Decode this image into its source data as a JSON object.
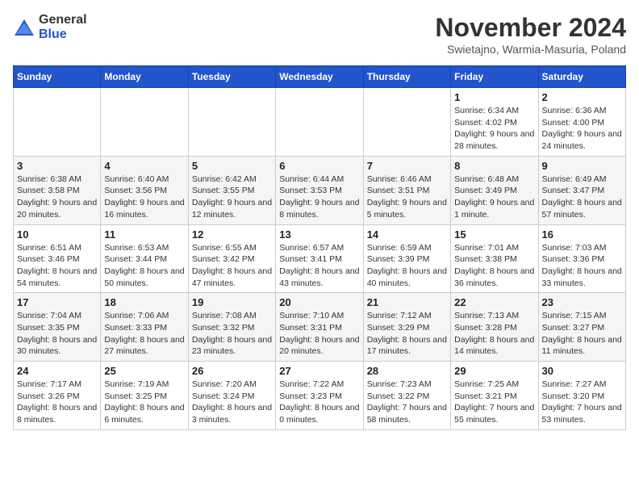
{
  "logo": {
    "general": "General",
    "blue": "Blue"
  },
  "header": {
    "month": "November 2024",
    "location": "Swietajno, Warmia-Masuria, Poland"
  },
  "weekdays": [
    "Sunday",
    "Monday",
    "Tuesday",
    "Wednesday",
    "Thursday",
    "Friday",
    "Saturday"
  ],
  "weeks": [
    [
      {
        "day": "",
        "info": ""
      },
      {
        "day": "",
        "info": ""
      },
      {
        "day": "",
        "info": ""
      },
      {
        "day": "",
        "info": ""
      },
      {
        "day": "",
        "info": ""
      },
      {
        "day": "1",
        "info": "Sunrise: 6:34 AM\nSunset: 4:02 PM\nDaylight: 9 hours and 28 minutes."
      },
      {
        "day": "2",
        "info": "Sunrise: 6:36 AM\nSunset: 4:00 PM\nDaylight: 9 hours and 24 minutes."
      }
    ],
    [
      {
        "day": "3",
        "info": "Sunrise: 6:38 AM\nSunset: 3:58 PM\nDaylight: 9 hours and 20 minutes."
      },
      {
        "day": "4",
        "info": "Sunrise: 6:40 AM\nSunset: 3:56 PM\nDaylight: 9 hours and 16 minutes."
      },
      {
        "day": "5",
        "info": "Sunrise: 6:42 AM\nSunset: 3:55 PM\nDaylight: 9 hours and 12 minutes."
      },
      {
        "day": "6",
        "info": "Sunrise: 6:44 AM\nSunset: 3:53 PM\nDaylight: 9 hours and 8 minutes."
      },
      {
        "day": "7",
        "info": "Sunrise: 6:46 AM\nSunset: 3:51 PM\nDaylight: 9 hours and 5 minutes."
      },
      {
        "day": "8",
        "info": "Sunrise: 6:48 AM\nSunset: 3:49 PM\nDaylight: 9 hours and 1 minute."
      },
      {
        "day": "9",
        "info": "Sunrise: 6:49 AM\nSunset: 3:47 PM\nDaylight: 8 hours and 57 minutes."
      }
    ],
    [
      {
        "day": "10",
        "info": "Sunrise: 6:51 AM\nSunset: 3:46 PM\nDaylight: 8 hours and 54 minutes."
      },
      {
        "day": "11",
        "info": "Sunrise: 6:53 AM\nSunset: 3:44 PM\nDaylight: 8 hours and 50 minutes."
      },
      {
        "day": "12",
        "info": "Sunrise: 6:55 AM\nSunset: 3:42 PM\nDaylight: 8 hours and 47 minutes."
      },
      {
        "day": "13",
        "info": "Sunrise: 6:57 AM\nSunset: 3:41 PM\nDaylight: 8 hours and 43 minutes."
      },
      {
        "day": "14",
        "info": "Sunrise: 6:59 AM\nSunset: 3:39 PM\nDaylight: 8 hours and 40 minutes."
      },
      {
        "day": "15",
        "info": "Sunrise: 7:01 AM\nSunset: 3:38 PM\nDaylight: 8 hours and 36 minutes."
      },
      {
        "day": "16",
        "info": "Sunrise: 7:03 AM\nSunset: 3:36 PM\nDaylight: 8 hours and 33 minutes."
      }
    ],
    [
      {
        "day": "17",
        "info": "Sunrise: 7:04 AM\nSunset: 3:35 PM\nDaylight: 8 hours and 30 minutes."
      },
      {
        "day": "18",
        "info": "Sunrise: 7:06 AM\nSunset: 3:33 PM\nDaylight: 8 hours and 27 minutes."
      },
      {
        "day": "19",
        "info": "Sunrise: 7:08 AM\nSunset: 3:32 PM\nDaylight: 8 hours and 23 minutes."
      },
      {
        "day": "20",
        "info": "Sunrise: 7:10 AM\nSunset: 3:31 PM\nDaylight: 8 hours and 20 minutes."
      },
      {
        "day": "21",
        "info": "Sunrise: 7:12 AM\nSunset: 3:29 PM\nDaylight: 8 hours and 17 minutes."
      },
      {
        "day": "22",
        "info": "Sunrise: 7:13 AM\nSunset: 3:28 PM\nDaylight: 8 hours and 14 minutes."
      },
      {
        "day": "23",
        "info": "Sunrise: 7:15 AM\nSunset: 3:27 PM\nDaylight: 8 hours and 11 minutes."
      }
    ],
    [
      {
        "day": "24",
        "info": "Sunrise: 7:17 AM\nSunset: 3:26 PM\nDaylight: 8 hours and 8 minutes."
      },
      {
        "day": "25",
        "info": "Sunrise: 7:19 AM\nSunset: 3:25 PM\nDaylight: 8 hours and 6 minutes."
      },
      {
        "day": "26",
        "info": "Sunrise: 7:20 AM\nSunset: 3:24 PM\nDaylight: 8 hours and 3 minutes."
      },
      {
        "day": "27",
        "info": "Sunrise: 7:22 AM\nSunset: 3:23 PM\nDaylight: 8 hours and 0 minutes."
      },
      {
        "day": "28",
        "info": "Sunrise: 7:23 AM\nSunset: 3:22 PM\nDaylight: 7 hours and 58 minutes."
      },
      {
        "day": "29",
        "info": "Sunrise: 7:25 AM\nSunset: 3:21 PM\nDaylight: 7 hours and 55 minutes."
      },
      {
        "day": "30",
        "info": "Sunrise: 7:27 AM\nSunset: 3:20 PM\nDaylight: 7 hours and 53 minutes."
      }
    ]
  ]
}
